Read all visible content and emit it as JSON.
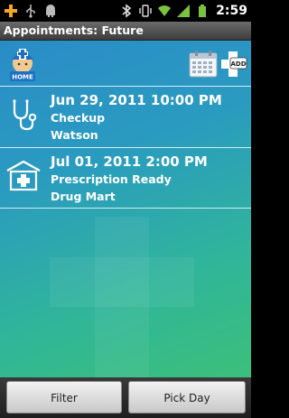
{
  "status_bar": {
    "time": "2:59",
    "left_icons": [
      "add-icon",
      "usb-icon",
      "android-icon"
    ],
    "right_icons": [
      "bluetooth-icon",
      "vibrate-icon",
      "wifi-icon",
      "signal-icon",
      "battery-icon"
    ]
  },
  "title_bar": {
    "title": "Appointments: Future"
  },
  "toolbar": {
    "home_label": "HOME",
    "add_label": "ADD"
  },
  "appointments": [
    {
      "date": "Jun 29, 2011 10:00 PM",
      "type": "Checkup",
      "location": "Watson",
      "icon": "stethoscope-icon"
    },
    {
      "date": "Jul 01, 2011 2:00 PM",
      "type": "Prescription Ready",
      "location": "Drug Mart",
      "icon": "pharmacy-icon"
    }
  ],
  "bottom_bar": {
    "filter_label": "Filter",
    "pick_day_label": "Pick Day"
  },
  "colors": {
    "background_top": "#2a8cc7",
    "background_bottom": "#3bc07a",
    "text": "#ffffff"
  }
}
